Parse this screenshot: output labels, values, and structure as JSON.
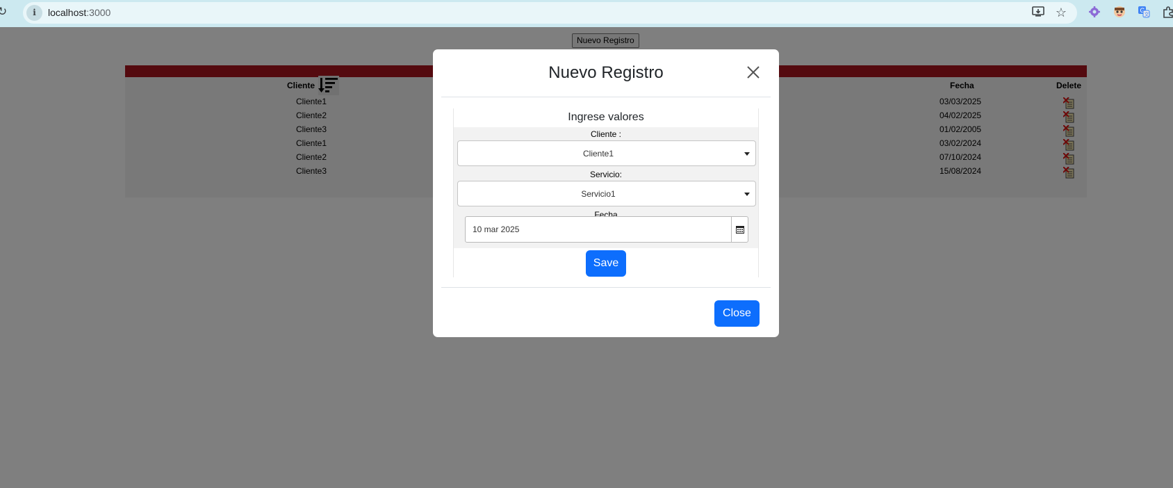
{
  "browser": {
    "url_host": "localhost",
    "url_port": ":3000",
    "extensions": [
      "gear-extension-icon",
      "face-extension-icon",
      "translate-extension-icon",
      "puzzle-extension-icon"
    ]
  },
  "page": {
    "new_record_button": "Nuevo Registro",
    "table": {
      "headers": {
        "cliente": "Cliente",
        "fecha": "Fecha",
        "delete": "Delete"
      },
      "rows": [
        {
          "cliente": "Cliente1",
          "fecha": "03/03/2025"
        },
        {
          "cliente": "Cliente2",
          "fecha": "04/02/2025"
        },
        {
          "cliente": "Cliente3",
          "fecha": "01/02/2005"
        },
        {
          "cliente": "Cliente1",
          "fecha": "03/02/2024"
        },
        {
          "cliente": "Cliente2",
          "fecha": "07/10/2024"
        },
        {
          "cliente": "Cliente3",
          "fecha": "15/08/2024"
        }
      ]
    }
  },
  "modal": {
    "title": "Nuevo Registro",
    "form_heading": "Ingrese valores",
    "cliente_label": "Cliente :",
    "cliente_value": "Cliente1",
    "servicio_label": "Servicio:",
    "servicio_value": "Servicio1",
    "fecha_label": "Fecha",
    "fecha_value": "10 mar 2025",
    "save_label": "Save",
    "close_label": "Close"
  },
  "colors": {
    "primary_button": "#0d6efd",
    "table_header_bar": "#a9151f",
    "overlay": "rgba(0,0,0,0.5)"
  }
}
